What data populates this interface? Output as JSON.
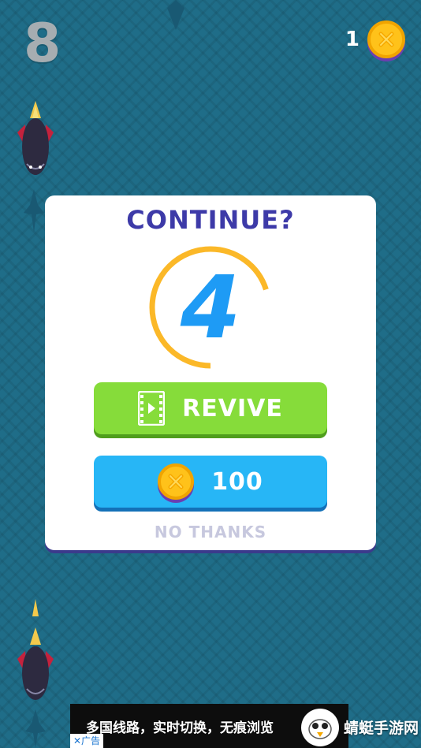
{
  "hud": {
    "score": "8",
    "coins": "1",
    "coin_icon": "coin-icon"
  },
  "dialog": {
    "title": "CONTINUE?",
    "countdown": "4",
    "timer_remaining_fraction": 0.7,
    "revive_label": "REVIVE",
    "revive_icon": "film-strip-icon",
    "coin_cost": "100",
    "no_thanks": "NO THANKS"
  },
  "ad": {
    "text": "多国线路，实时切换，无痕浏览",
    "tag": "✕广告",
    "brand": "蜻蜓手游网"
  },
  "colors": {
    "sea": "#1f6d88",
    "title": "#3d3aa8",
    "revive": "#86dc3a",
    "coins_button": "#27b6f6",
    "timer_ring": "#fbb828",
    "countdown": "#1e9bf5"
  }
}
